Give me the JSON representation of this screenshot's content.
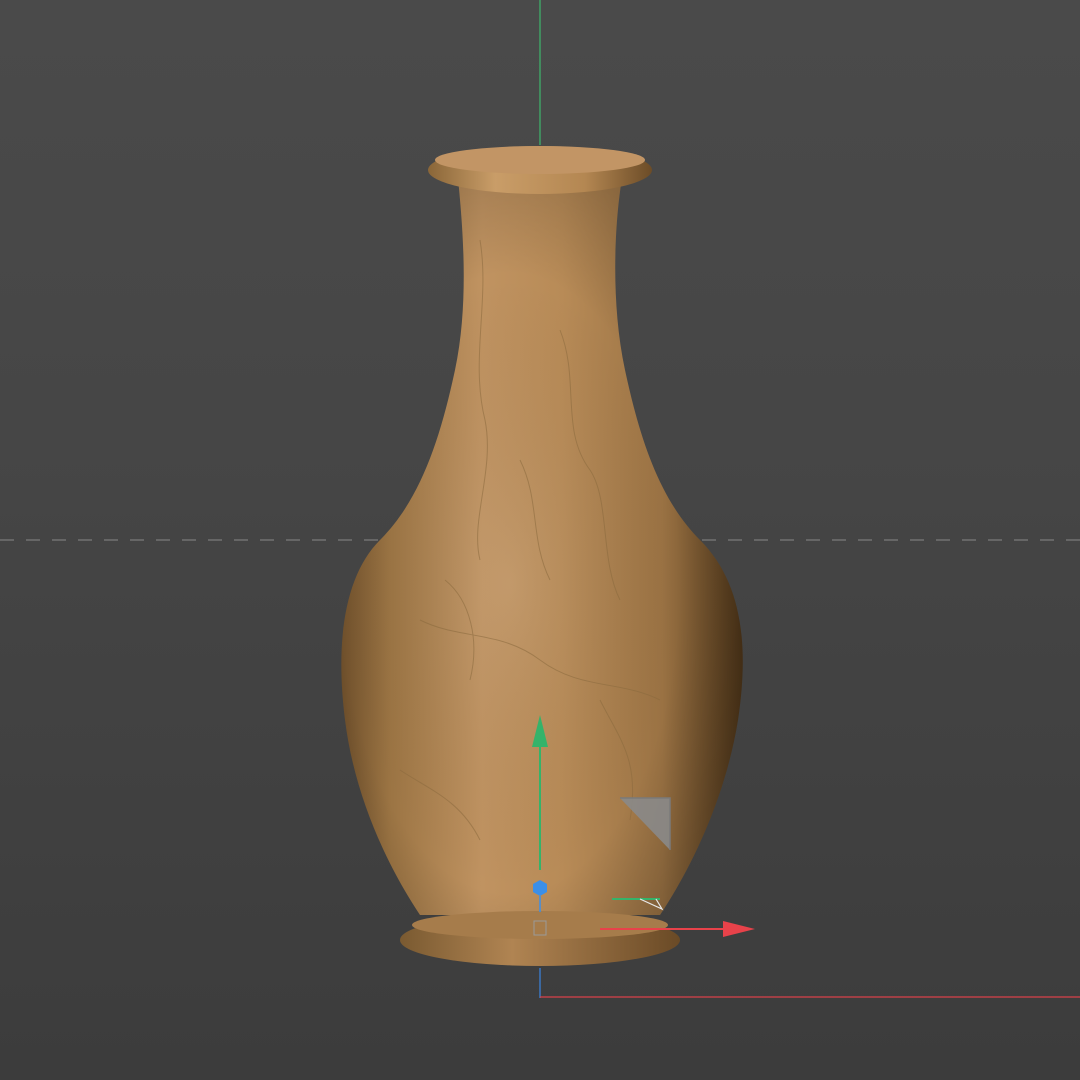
{
  "viewport": {
    "label": "",
    "background_color": "#464646"
  },
  "scene": {
    "object": {
      "name": "vase",
      "material": "beige-marble",
      "base_color": "#b58a55",
      "highlight_color": "#d2ae7c",
      "shadow_color": "#6e4f2b"
    },
    "grid": {
      "horizon_line": "dashed",
      "horizon_color": "#7a7a7a"
    },
    "world_axes": {
      "x_color": "#d9414a",
      "y_color": "#3fae6a",
      "z_color": "#3b7fd6"
    },
    "gizmo": {
      "type": "move-tool",
      "x_handle_color": "#e8424a",
      "y_handle_color": "#35b36a",
      "center_handle_color": "#3b8fe8",
      "plane_handle_color": "#9a9a9a",
      "icons": [
        "x-arrow-icon",
        "y-arrow-icon",
        "center-handle-icon",
        "plane-handle-icon",
        "pivot-box-icon"
      ]
    }
  }
}
